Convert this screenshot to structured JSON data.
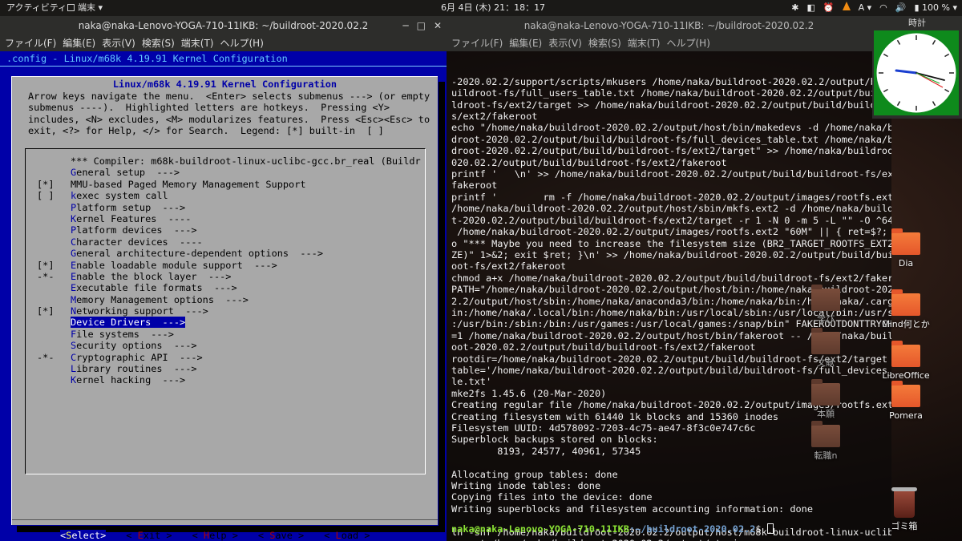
{
  "topbar": {
    "activities": "アクティビティ",
    "app_menu": "端末 ▾",
    "datetime": "6月 4日 (木) 21：18：17",
    "tray": {
      "input_method": "A ▾",
      "wifi": "◠",
      "volume": "🔊",
      "battery": "▮ 100 % ▾"
    }
  },
  "left_window": {
    "title": "naka@naka-Lenovo-YOGA-710-11IKB: ~/buildroot-2020.02.2",
    "menu": [
      "ファイル(F)",
      "編集(E)",
      "表示(V)",
      "検索(S)",
      "端末(T)",
      "ヘルプ(H)"
    ],
    "header": ".config - Linux/m68k 4.19.91 Kernel Configuration",
    "dialog_title": "Linux/m68k 4.19.91 Kernel Configuration",
    "help_text": "Arrow keys navigate the menu.  <Enter> selects submenus ---> (or empty\nsubmenus ----).  Highlighted letters are hotkeys.  Pressing <Y>\nincludes, <N> excludes, <M> modularizes features.  Press <Esc><Esc> to\nexit, <?> for Help, </> for Search.  Legend: [*] built-in  [ ]",
    "items": [
      {
        "prefix": "",
        "hk": "",
        "rest": "*** Compiler: m68k-buildroot-linux-uclibc-gcc.br_real (Buildr"
      },
      {
        "prefix": "",
        "hk": "G",
        "rest": "eneral setup  --->"
      },
      {
        "prefix": "[*]",
        "hk": "",
        "rest": "MMU-based Paged Memory Management Support"
      },
      {
        "prefix": "[ ]",
        "hk": "k",
        "rest": "exec system call"
      },
      {
        "prefix": "",
        "hk": "P",
        "rest": "latform setup  --->"
      },
      {
        "prefix": "",
        "hk": "K",
        "rest": "ernel Features  ----"
      },
      {
        "prefix": "",
        "hk": "P",
        "rest": "latform devices  --->"
      },
      {
        "prefix": "",
        "hk": "C",
        "rest": "haracter devices  ----"
      },
      {
        "prefix": "",
        "hk": "G",
        "rest": "eneral architecture-dependent options  --->"
      },
      {
        "prefix": "[*]",
        "hk": "E",
        "rest": "nable loadable module support  --->"
      },
      {
        "prefix": "-*-",
        "hk": "E",
        "rest": "nable the block layer  --->"
      },
      {
        "prefix": "",
        "hk": "E",
        "rest": "xecutable file formats  --->"
      },
      {
        "prefix": "",
        "hk": "M",
        "rest": "emory Management options  --->"
      },
      {
        "prefix": "[*]",
        "hk": "N",
        "rest": "etworking support  --->"
      },
      {
        "prefix": "",
        "hk": "D",
        "rest": "evice Drivers  --->",
        "selected": true
      },
      {
        "prefix": "",
        "hk": "F",
        "rest": "ile systems  --->"
      },
      {
        "prefix": "",
        "hk": "S",
        "rest": "ecurity options  --->"
      },
      {
        "prefix": "-*-",
        "hk": "C",
        "rest": "ryptographic API  --->"
      },
      {
        "prefix": "",
        "hk": "L",
        "rest": "ibrary routines  --->"
      },
      {
        "prefix": "",
        "hk": "K",
        "rest": "ernel hacking  --->"
      }
    ],
    "buttons": [
      {
        "pre": "<",
        "hk": "S",
        "post": "elect>",
        "active": true
      },
      {
        "pre": "< ",
        "hk": "E",
        "post": "xit >",
        "active": false
      },
      {
        "pre": "< ",
        "hk": "H",
        "post": "elp >",
        "active": false
      },
      {
        "pre": "< ",
        "hk": "S",
        "post": "ave >",
        "active": false
      },
      {
        "pre": "< ",
        "hk": "L",
        "post": "oad >",
        "active": false
      }
    ]
  },
  "right_window": {
    "title": "naka@naka-Lenovo-YOGA-710-11IKB: ~/buildroot-2020.02.2",
    "menu": [
      "ファイル(F)",
      "編集(E)",
      "表示(V)",
      "検索(S)",
      "端末(T)",
      "ヘルプ(H)"
    ],
    "output": "-2020.02.2/support/scripts/mkusers /home/naka/buildroot-2020.02.2/output/buil\nuildroot-fs/full_users_table.txt /home/naka/buildroot-2020.02.2/output/build/\nldroot-fs/ext2/target >> /home/naka/buildroot-2020.02.2/output/build/buildroo\ns/ext2/fakeroot\necho \"/home/naka/buildroot-2020.02.2/output/host/bin/makedevs -d /home/naka/b\ndroot-2020.02.2/output/build/buildroot-fs/full_devices_table.txt /home/naka/b\ndroot-2020.02.2/output/build/buildroot-fs/ext2/target\" >> /home/naka/buildroot-2\n020.02.2/output/build/buildroot-fs/ext2/fakeroot\nprintf '   \\n' >> /home/naka/buildroot-2020.02.2/output/build/buildroot-fs/ext2/\nfakeroot\nprintf '        rm -f /home/naka/buildroot-2020.02.2/output/images/rootfs.ext2\\n\n/home/naka/buildroot-2020.02.2/output/host/sbin/mkfs.ext2 -d /home/naka/buildroo\nt-2020.02.2/output/build/buildroot-fs/ext2/target -r 1 -N 0 -m 5 -L \"\" -O ^64bit\n /home/naka/buildroot-2020.02.2/output/images/rootfs.ext2 \"60M\" || { ret=$?; ech\no \"*** Maybe you need to increase the filesystem size (BR2_TARGET_ROOTFS_EXT2_SI\nZE)\" 1>&2; exit $ret; }\\n' >> /home/naka/buildroot-2020.02.2/output/build/buildr\noot-fs/ext2/fakeroot\nchmod a+x /home/naka/buildroot-2020.02.2/output/build/buildroot-fs/ext2/fakeroot\nPATH=\"/home/naka/buildroot-2020.02.2/output/host/bin:/home/naka/buildroot-2020.0\n2.2/output/host/sbin:/home/naka/anaconda3/bin:/home/naka/bin:/home/naka/.cargo/b\nin:/home/naka/.local/bin:/home/naka/bin:/usr/local/sbin:/usr/local/bin:/usr/sbin\n:/usr/bin:/sbin:/bin:/usr/games:/usr/local/games:/snap/bin\" FAKEROOTDONTTRYCHOWN\n=1 /home/naka/buildroot-2020.02.2/output/host/bin/fakeroot -- /home/naka/buildr\noot-2020.02.2/output/build/buildroot-fs/ext2/fakeroot\nrootdir=/home/naka/buildroot-2020.02.2/output/build/buildroot-fs/ext2/target\ntable='/home/naka/buildroot-2020.02.2/output/build/buildroot-fs/full_devices_tab\nle.txt'\nmke2fs 1.45.6 (20-Mar-2020)\nCreating regular file /home/naka/buildroot-2020.02.2/output/images/rootfs.ext2\nCreating filesystem with 61440 1k blocks and 15360 inodes\nFilesystem UUID: 4d578092-7203-4c75-ae47-8f3c0e747c6c\nSuperblock backups stored on blocks:\n        8193, 24577, 40961, 57345\n\nAllocating group tables: done\nWriting inode tables: done\nCopying files into the device: done\nWriting superblocks and filesystem accounting information: done\n\nln -snf /home/naka/buildroot-2020.02.2/output/host/m68k-buildroot-linux-uclibc/s\nysroot /home/naka/buildroot-2020.02.2/output/staging",
    "prompt_user": "naka@naka-Lenovo-YOGA-710-11IKB",
    "prompt_path": ":~/buildroot-2020.02.2",
    "prompt_symbol": "$"
  },
  "clock_widget": {
    "title": "時計"
  },
  "desktop_icons": [
    {
      "label": "Dia"
    },
    {
      "label": "Mind何とか"
    },
    {
      "label": "LibreOffice"
    },
    {
      "label": "Pomera"
    },
    {
      "label": "学び"
    },
    {
      "label": "文献"
    },
    {
      "label": "本願"
    },
    {
      "label": "転職n"
    },
    {
      "label": "ゴミ箱"
    }
  ]
}
